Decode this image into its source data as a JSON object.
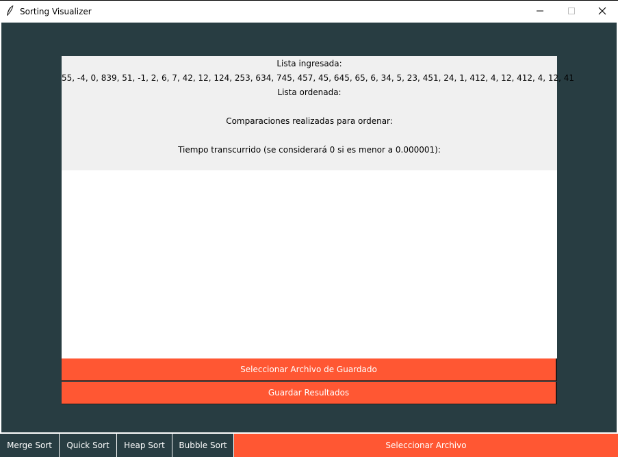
{
  "window": {
    "title": "Sorting Visualizer",
    "icons": [
      "feather-icon",
      "minimize-icon",
      "maximize-icon",
      "close-icon"
    ]
  },
  "info": {
    "input_label": "Lista ingresada:",
    "input_values": "55, -4, 0, 839, 51, -1, 2, 6, 7, 42, 12, 124, 253, 634, 745, 457, 45, 645, 65, 6, 34, 5, 23, 451, 24, 1, 412, 4, 12, 412, 4, 12, 41",
    "sorted_label": "Lista ordenada:",
    "sorted_values": "",
    "comparisons_label": "Comparaciones realizadas para ordenar:",
    "comparisons_value": "",
    "time_label": "Tiempo transcurrido (se considerará 0 si es menor a 0.000001):"
  },
  "actions": {
    "select_save_file": "Seleccionar Archivo de Guardado",
    "save_results": "Guardar Resultados"
  },
  "bottom": {
    "merge_sort": "Merge Sort",
    "quick_sort": "Quick Sort",
    "heap_sort": "Heap Sort",
    "bubble_sort": "Bubble Sort",
    "select_file": "Seleccionar Archivo"
  },
  "colors": {
    "background": "#283d42",
    "accent": "#ff5733",
    "panel": "#f0f0f0"
  }
}
